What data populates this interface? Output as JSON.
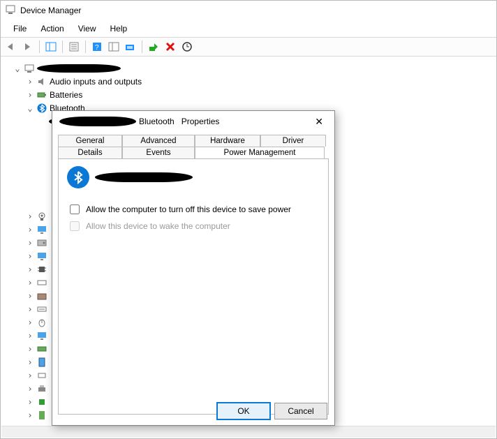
{
  "window": {
    "title": "Device Manager"
  },
  "menu": {
    "file": "File",
    "action": "Action",
    "view": "View",
    "help": "Help"
  },
  "tree": {
    "root": "████████████",
    "audio": "Audio inputs and outputs",
    "batteries": "Batteries",
    "bluetooth": "Bluetooth",
    "bt_device": "██████████"
  },
  "dialog": {
    "title_prefix": "██████████ Bluetooth",
    "title_suffix": "Properties",
    "tabs": {
      "general": "General",
      "advanced": "Advanced",
      "hardware": "Hardware",
      "driver": "Driver",
      "details": "Details",
      "events": "Events",
      "power": "Power Management"
    },
    "device_name": "██████████",
    "opt_allow_off": "Allow the computer to turn off this device to save power",
    "opt_allow_wake": "Allow this device to wake the computer",
    "ok": "OK",
    "cancel": "Cancel"
  }
}
